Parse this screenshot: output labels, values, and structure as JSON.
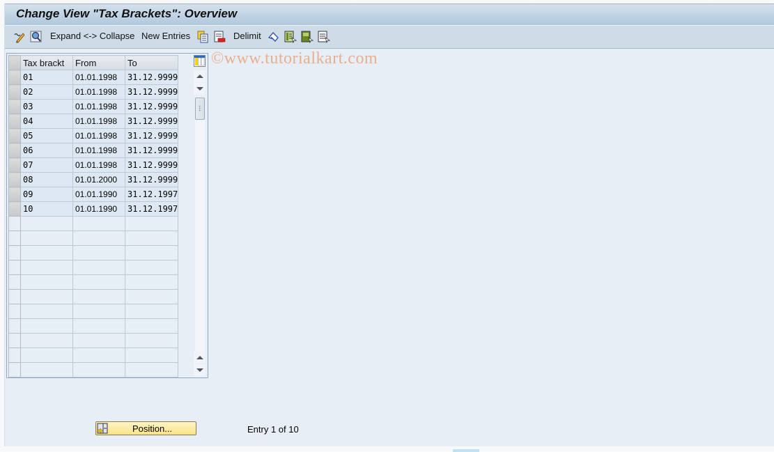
{
  "window": {
    "title": "Change View \"Tax Brackets\": Overview"
  },
  "toolbar": {
    "items": [
      {
        "type": "icon",
        "icon": "display-change-icon",
        "label": "Display <-> Change"
      },
      {
        "type": "icon",
        "icon": "find-icon",
        "label": "Find"
      },
      {
        "type": "text",
        "label": "Expand <-> Collapse"
      },
      {
        "type": "text",
        "label": "New Entries"
      },
      {
        "type": "icon",
        "icon": "copy-as-icon",
        "label": "Copy As"
      },
      {
        "type": "icon",
        "icon": "delete-icon",
        "label": "Delete"
      },
      {
        "type": "text",
        "label": "Delimit"
      },
      {
        "type": "icon",
        "icon": "undo-change-icon",
        "label": "Undo Change"
      },
      {
        "type": "icon",
        "icon": "select-all-icon",
        "label": "Select All"
      },
      {
        "type": "icon",
        "icon": "select-block-icon",
        "label": "Select Block"
      },
      {
        "type": "icon",
        "icon": "deselect-all-icon",
        "label": "Deselect All"
      }
    ],
    "watermark": "©www.tutorialkart.com"
  },
  "table": {
    "columns": [
      "Tax brackt",
      "From",
      "To"
    ],
    "rows": [
      {
        "bracket": "01",
        "from": "01.01.1998",
        "to": "31.12.9999"
      },
      {
        "bracket": "02",
        "from": "01.01.1998",
        "to": "31.12.9999"
      },
      {
        "bracket": "03",
        "from": "01.01.1998",
        "to": "31.12.9999"
      },
      {
        "bracket": "04",
        "from": "01.01.1998",
        "to": "31.12.9999"
      },
      {
        "bracket": "05",
        "from": "01.01.1998",
        "to": "31.12.9999"
      },
      {
        "bracket": "06",
        "from": "01.01.1998",
        "to": "31.12.9999"
      },
      {
        "bracket": "07",
        "from": "01.01.1998",
        "to": "31.12.9999"
      },
      {
        "bracket": "08",
        "from": "01.01.2000",
        "to": "31.12.9999"
      },
      {
        "bracket": "09",
        "from": "01.01.1990",
        "to": "31.12.1997"
      },
      {
        "bracket": "10",
        "from": "01.01.1990",
        "to": "31.12.1997"
      }
    ],
    "empty_rows": 11
  },
  "footer": {
    "position_button": "Position...",
    "entry_info": "Entry 1 of 10"
  }
}
